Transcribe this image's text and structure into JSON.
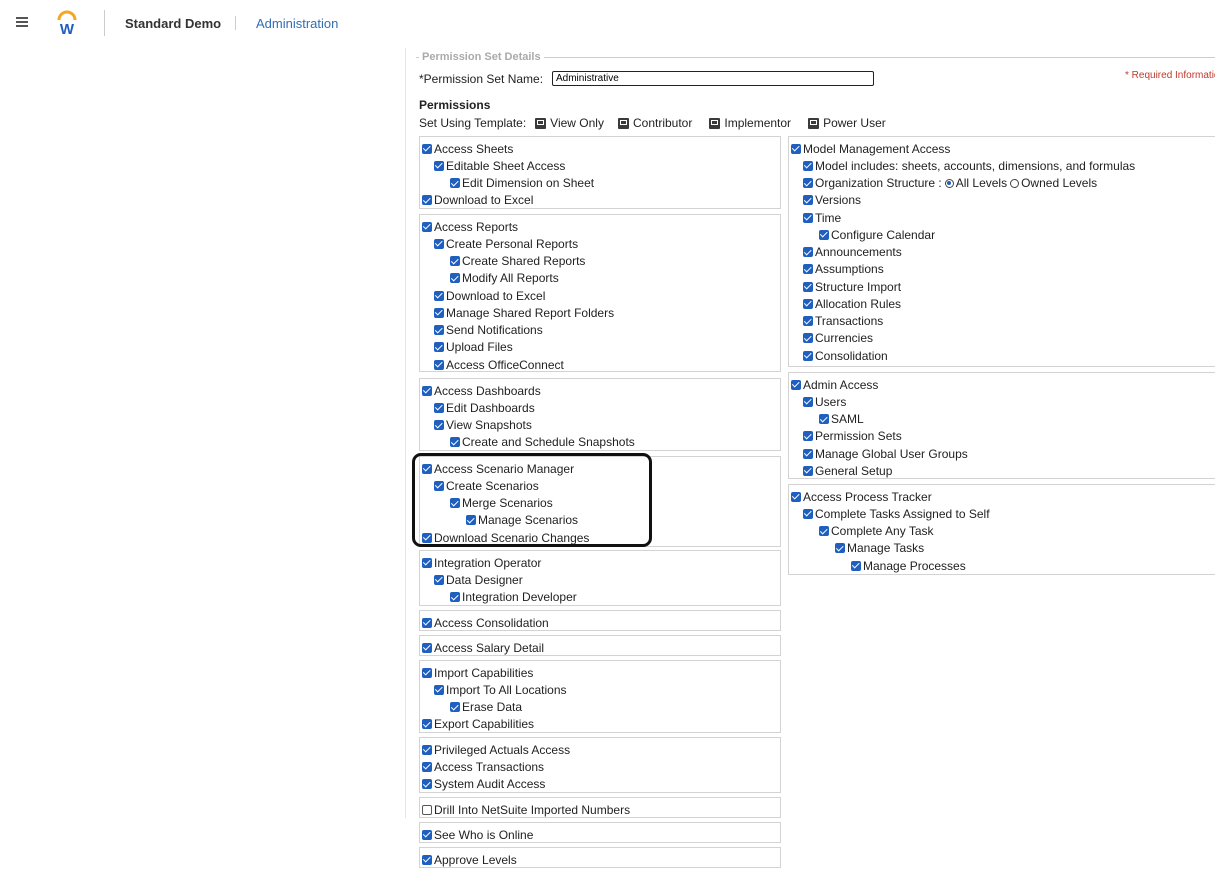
{
  "topbar": {
    "tenant": "Standard Demo",
    "crumb": "Administration",
    "logo_letter": "W",
    "logo_colors": {
      "arc": "#f5a623",
      "letter": "#1f5fc0"
    }
  },
  "form": {
    "legend": "Permission Set Details",
    "name_label": "*Permission Set Name:",
    "name_value": "Administrative",
    "required_note": "* Required Information",
    "permissions_heading": "Permissions",
    "template_label": "Set Using Template:",
    "templates": [
      "View Only",
      "Contributor",
      "Implementor",
      "Power User"
    ]
  },
  "colors": {
    "checkbox": "#1f5fc0",
    "required": "#c0392b",
    "link": "#2f6fb3"
  },
  "left_groups": [
    [
      {
        "label": "Access Sheets",
        "level": 0,
        "checked": true
      },
      {
        "label": "Editable Sheet Access",
        "level": 1,
        "checked": true
      },
      {
        "label": "Edit Dimension on Sheet",
        "level": 2,
        "checked": true
      },
      {
        "label": "Download to Excel",
        "level": 0,
        "checked": true
      }
    ],
    [
      {
        "label": "Access Reports",
        "level": 0,
        "checked": true
      },
      {
        "label": "Create Personal Reports",
        "level": 1,
        "checked": true
      },
      {
        "label": "Create Shared Reports",
        "level": 2,
        "checked": true
      },
      {
        "label": "Modify All Reports",
        "level": 2,
        "checked": true
      },
      {
        "label": "Download to Excel",
        "level": 1,
        "checked": true
      },
      {
        "label": "Manage Shared Report Folders",
        "level": 1,
        "checked": true
      },
      {
        "label": "Send Notifications",
        "level": 1,
        "checked": true
      },
      {
        "label": "Upload Files",
        "level": 1,
        "checked": true
      },
      {
        "label": "Access OfficeConnect",
        "level": 1,
        "checked": true
      }
    ],
    [
      {
        "label": "Access Dashboards",
        "level": 0,
        "checked": true
      },
      {
        "label": "Edit Dashboards",
        "level": 1,
        "checked": true
      },
      {
        "label": "View Snapshots",
        "level": 1,
        "checked": true
      },
      {
        "label": "Create and Schedule Snapshots",
        "level": 2,
        "checked": true
      }
    ],
    [
      {
        "label": "Access Scenario Manager",
        "level": 0,
        "checked": true
      },
      {
        "label": "Create Scenarios",
        "level": 1,
        "checked": true
      },
      {
        "label": "Merge Scenarios",
        "level": 2,
        "checked": true
      },
      {
        "label": "Manage Scenarios",
        "level": 3,
        "checked": true
      },
      {
        "label": "Download Scenario Changes",
        "level": 0,
        "checked": true
      }
    ],
    [
      {
        "label": "Integration Operator",
        "level": 0,
        "checked": true
      },
      {
        "label": "Data Designer",
        "level": 1,
        "checked": true
      },
      {
        "label": "Integration Developer",
        "level": 2,
        "checked": true
      }
    ],
    [
      {
        "label": "Access Consolidation",
        "level": 0,
        "checked": true
      }
    ],
    [
      {
        "label": "Access Salary Detail",
        "level": 0,
        "checked": true
      }
    ],
    [
      {
        "label": "Import Capabilities",
        "level": 0,
        "checked": true
      },
      {
        "label": "Import To All Locations",
        "level": 1,
        "checked": true
      },
      {
        "label": "Erase Data",
        "level": 2,
        "checked": true
      },
      {
        "label": "Export Capabilities",
        "level": 0,
        "checked": true
      }
    ],
    [
      {
        "label": "Privileged Actuals Access",
        "level": 0,
        "checked": true
      },
      {
        "label": "Access Transactions",
        "level": 0,
        "checked": true
      },
      {
        "label": "System Audit Access",
        "level": 0,
        "checked": true
      }
    ],
    [
      {
        "label": "Drill Into NetSuite Imported Numbers",
        "level": 0,
        "checked": false
      }
    ],
    [
      {
        "label": "See Who is Online",
        "level": 0,
        "checked": true
      }
    ],
    [
      {
        "label": "Approve Levels",
        "level": 0,
        "checked": true
      }
    ]
  ],
  "right_groups": [
    [
      {
        "label": "Model Management Access",
        "level": 0,
        "checked": true
      },
      {
        "label": "Model includes: sheets, accounts, dimensions, and formulas",
        "level": 1,
        "checked": true
      },
      {
        "label": "Organization Structure :",
        "level": 1,
        "checked": true,
        "radios": [
          {
            "label": "All Levels",
            "selected": true
          },
          {
            "label": "Owned Levels",
            "selected": false
          }
        ]
      },
      {
        "label": "Versions",
        "level": 1,
        "checked": true
      },
      {
        "label": "Time",
        "level": 1,
        "checked": true
      },
      {
        "label": "Configure Calendar",
        "level": 2,
        "checked": true
      },
      {
        "label": "Announcements",
        "level": 1,
        "checked": true
      },
      {
        "label": "Assumptions",
        "level": 1,
        "checked": true
      },
      {
        "label": "Structure Import",
        "level": 1,
        "checked": true
      },
      {
        "label": "Allocation Rules",
        "level": 1,
        "checked": true
      },
      {
        "label": "Transactions",
        "level": 1,
        "checked": true
      },
      {
        "label": "Currencies",
        "level": 1,
        "checked": true
      },
      {
        "label": "Consolidation",
        "level": 1,
        "checked": true
      }
    ],
    [
      {
        "label": "Admin Access",
        "level": 0,
        "checked": true
      },
      {
        "label": "Users",
        "level": 1,
        "checked": true
      },
      {
        "label": "SAML",
        "level": 2,
        "checked": true
      },
      {
        "label": "Permission Sets",
        "level": 1,
        "checked": true
      },
      {
        "label": "Manage Global User Groups",
        "level": 1,
        "checked": true
      },
      {
        "label": "General Setup",
        "level": 1,
        "checked": true
      }
    ],
    [
      {
        "label": "Access Process Tracker",
        "level": 0,
        "checked": true
      },
      {
        "label": "Complete Tasks Assigned to Self",
        "level": 1,
        "checked": true
      },
      {
        "label": "Complete Any Task",
        "level": 2,
        "checked": true
      },
      {
        "label": "Manage Tasks",
        "level": 3,
        "checked": true
      },
      {
        "label": "Manage Processes",
        "level": 4,
        "checked": true
      }
    ]
  ]
}
